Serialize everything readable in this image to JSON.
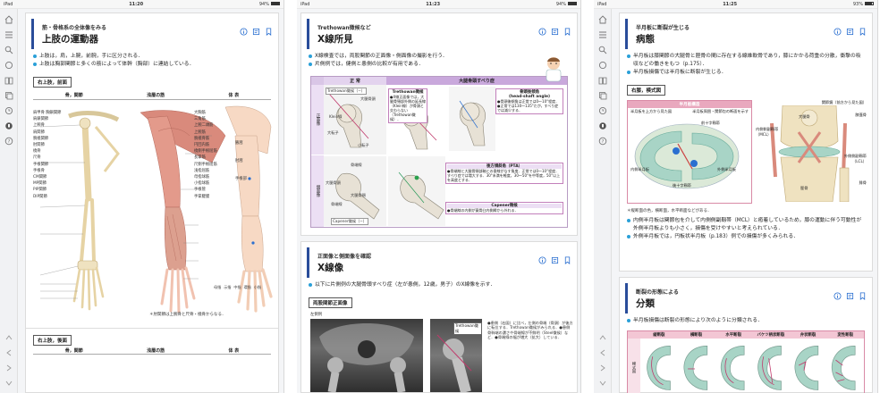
{
  "screens": [
    {
      "status": {
        "left": "iPad",
        "time": "11:20",
        "battery": "94%",
        "battery_level": 0.94
      },
      "rail_icons": [
        "home-icon",
        "list-icon",
        "search-icon",
        "circle-icon",
        "book-icon",
        "layers-icon",
        "history-icon",
        "bookmark-icon",
        "help-icon"
      ],
      "rail_bottom_icons": [
        "up-arrow-icon",
        "back-arrow-icon",
        "forward-arrow-icon",
        "down-arrow-icon"
      ],
      "section": {
        "subtitle": "筋・骨格系の全体像をみる",
        "title": "上肢の運動器",
        "bullets": [
          "上肢は，肩，上腕，前腕，手に区分される．",
          "上肢は胸郭関節と多くの筋によって体幹（胸部）に連結している．"
        ],
        "box_label": "右上肢，前面",
        "col_headers": [
          "骨，関節",
          "浅層の筋",
          "体 表"
        ],
        "figure_labels_left": [
          "肩甲骨 胸鎖関節",
          "肩鎖関節",
          "上腕骨",
          "肩関節",
          "腕橈関節",
          "肘関節",
          "橈骨",
          "尺骨",
          "手根関節",
          "手根骨",
          "CM関節",
          "MP関節",
          "PIP関節",
          "DIP関節"
        ],
        "figure_labels_mid": [
          "大胸筋",
          "三角筋",
          "上腕二頭筋",
          "上腕筋",
          "腕橈骨筋",
          "円回内筋",
          "橈側手根屈筋",
          "長掌筋",
          "尺側手根屈筋",
          "浅指屈筋",
          "母指球筋",
          "小指球筋",
          "手根管",
          "手掌腱膜"
        ],
        "figure_labels_right": [
          "腋窩",
          "肘窩",
          "手根部",
          "母指",
          "示指",
          "中指",
          "環指",
          "小指"
        ],
        "footnote": "＊肘関節は上腕骨と尺骨・橈骨からなる．",
        "box_label_2": "右上肢，後面",
        "col_headers_2": [
          "骨，関節",
          "浅層の筋",
          "体 表"
        ]
      }
    },
    {
      "status": {
        "left": "iPad",
        "time": "11:23",
        "battery": "94%",
        "battery_level": 0.94
      },
      "section": {
        "subtitle": "Trethowan徴候など",
        "title": "X線所見",
        "bullets": [
          "X線検査では，両股関節の正面像・側面像の撮影を行う．",
          "片側例では，健側と患側の比較が有用である．"
        ],
        "table_head": [
          "正 常",
          "大腿骨頭すべり症"
        ],
        "row_labels": [
          "正面像",
          "側面像"
        ],
        "callout_1": "Trethowan徴候",
        "callout_1_text": "●X線正面像では，大腿骨頸部外側の延長線（Klein線）が骨頭と交わらない（Trethowan徴候）．",
        "callout_2": "骨頭後傾角\n(head-shaft angle)",
        "callout_2_text": "●骨頭後傾角は正常では0〜10°程度．●正常では130〜135°だが，すべり症では減少する．",
        "callout_3": "後方傾斜角（PTA）",
        "callout_3_text": "●骨端線と大腿骨頸部軸との垂線がなす角度．正常では0〜10°程度．すべり症では増大する．30°未満を軽度，30〜50°を中等度，50°以上を高度とする．",
        "callout_4": "Capener徴候",
        "callout_4_text": "●骨端線の内側が寛骨臼内側縁から外れる．",
        "labels_normal": [
          "Trethowan徴候（−）",
          "Klein線",
          "大腿骨頭",
          "小転子",
          "大転子",
          "骨端線",
          "大腿骨頭",
          "大腿骨頸",
          "骨端線",
          "Capener徴候（−）"
        ],
        "page2_subtitle": "正面像と側面像を確認",
        "page2_title": "X線像",
        "page2_bullet": "以下に片側例の大腿骨頭すべり症（左が患側，12歳，男子）のX線像を示す．",
        "page2_box_label": "両股関節正面像",
        "page2_xray_label": "左側例",
        "page2_callout": "Trethowan徴候",
        "page2_notes": "●患側（右図）に比べ，左側の骨端（骨頭）が後方に転位する．Trethowan徴候がみられる．●患側骨幹端の濃さや骨端線が不鮮明（Steel徴候）など．●骨端線の幅が増大（拡大）している．"
      }
    },
    {
      "status": {
        "left": "iPad",
        "time": "11:25",
        "battery": "93%",
        "battery_level": 0.93
      },
      "section": {
        "subtitle": "半月板に断裂が生じる",
        "title": "病態",
        "bullets": [
          "半月板は膝関節の大腿骨と脛骨の間に存在する線維軟骨であり，膝にかかる荷重の分散，衝撃の吸収などの働きをもつ（p.175）．",
          "半月板損傷では半月板に断裂が生じる．"
        ],
        "box_label": "右膝，模式図",
        "fig_title": "半月板構造",
        "fig_left_caption": "半月板を上方から見た図",
        "fig_mid_caption": "半月板周囲・関節包の断面を示す",
        "fig_right_caption": "関節鏡（前方から見た図）",
        "fig_labels": [
          "内側半月板",
          "外側半月板",
          "前十字靱帯",
          "後十字靱帯",
          "半月板前節",
          "半月板後節",
          "内側側副靱帯（MCL）",
          "外側側副靱帯（LCL）",
          "膝蓋骨",
          "脛骨",
          "腓骨",
          "大腿骨"
        ],
        "fig_note": "＊縦断面の色，横断面，水平断面などがある．",
        "bullets_2": [
          "内側半月板は関節包を介して内側側副靱帯（MCL）と癒着しているため，膝の運動に伴う可動性が外側半月板よりも小さく，損傷を受けやすいと考えられている．",
          "外側半月板では，円板状半月板（p.183）例での損傷が多くみられる．"
        ],
        "page2_subtitle": "断裂の形態による",
        "page2_title": "分類",
        "page2_bullet": "半月板損傷は断裂の形態により次のように分類される．",
        "tear_types": [
          "縦断裂",
          "横断裂",
          "水平断裂",
          "バケツ柄状断裂",
          "弁状断裂",
          "変性断裂"
        ],
        "tear_row_label": "模式図"
      }
    }
  ],
  "colors": {
    "accent": "#2a4d9a",
    "bullet": "#2aa0d8",
    "bone": "#efe2c0",
    "muscle": "#d98a7c",
    "skin": "#f7d9c4",
    "callout_border": "#c27fbb",
    "cartilage": "#a8d4c6"
  }
}
